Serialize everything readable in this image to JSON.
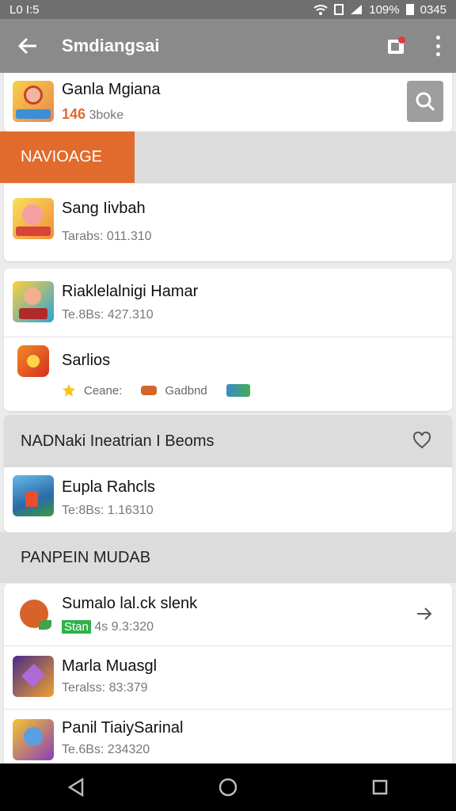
{
  "status": {
    "time": "L0 I:5",
    "battery_pct": "109%",
    "right_time": "0345"
  },
  "appbar": {
    "title": "Smdiangsai"
  },
  "top_item": {
    "title": "Ganla Mgiana",
    "count": "146",
    "subtitle": "3boke"
  },
  "tab": {
    "label": "NAVIOAGE"
  },
  "items1": [
    {
      "title": "Sang Iivbah",
      "meta": "Tarabs: 011.310"
    }
  ],
  "items2": [
    {
      "title": "Riaklelalnigi Hamar",
      "meta": "Te.8Bs: 427.310"
    },
    {
      "title": "Sarlios",
      "tags": [
        "Ceane:",
        "Gadbnd"
      ]
    }
  ],
  "section1": {
    "title": "NADNaki Ineatrian I Beoms"
  },
  "item3": {
    "title": "Eupla Rahcls",
    "meta": "Te:8Bs: 1.16310"
  },
  "section2": {
    "title": "PANPEIN MUDAB"
  },
  "items4": [
    {
      "title": "Sumalo lal.ck slenk",
      "badge": "Stan",
      "meta": "4s 9.3:320"
    },
    {
      "title": "Marla Muasgl",
      "meta": "Teralss: 83:379"
    },
    {
      "title": "Panil TiaiySarinal",
      "meta": "Te.6Bs: 234320"
    }
  ],
  "colors": {
    "accent": "#e06b2c",
    "appbar": "#8a8a8a",
    "green_badge": "#2fb24a"
  },
  "icons": [
    "back-arrow-icon",
    "gift-icon",
    "more-vert-icon",
    "search-icon",
    "heart-icon",
    "arrow-right-icon",
    "back-nav-icon",
    "home-nav-icon",
    "recents-nav-icon"
  ]
}
